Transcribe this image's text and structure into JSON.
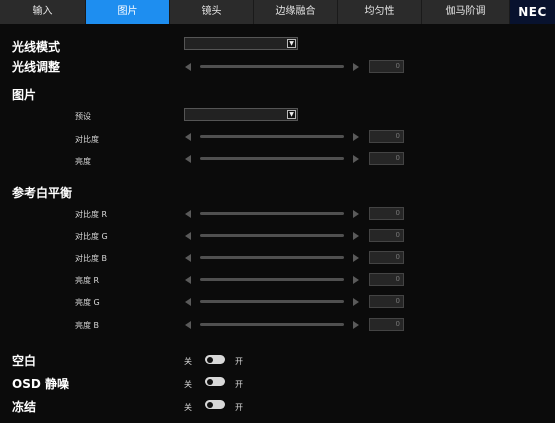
{
  "tabs": [
    {
      "label": "输入"
    },
    {
      "label": "图片"
    },
    {
      "label": "镜头"
    },
    {
      "label": "边缘融合"
    },
    {
      "label": "均匀性"
    },
    {
      "label": "伽马阶调"
    }
  ],
  "brand": {
    "logo_text": "NEC",
    "active_tab_color": "#1e8ef0"
  },
  "light": {
    "mode_label": "光线模式",
    "mode_value": "",
    "adjust_label": "光线调整",
    "adjust_value": "0"
  },
  "picture": {
    "heading": "图片",
    "preset_label": "预设",
    "preset_value": "",
    "contrast_label": "对比度",
    "contrast_value": "0",
    "brightness_label": "亮度",
    "brightness_value": "0"
  },
  "white_balance": {
    "heading": "参考白平衡",
    "items": [
      {
        "label": "对比度 R",
        "value": "0"
      },
      {
        "label": "对比度 G",
        "value": "0"
      },
      {
        "label": "对比度 B",
        "value": "0"
      },
      {
        "label": "亮度 R",
        "value": "0"
      },
      {
        "label": "亮度 G",
        "value": "0"
      },
      {
        "label": "亮度 B",
        "value": "0"
      }
    ]
  },
  "toggles": {
    "off_label": "关",
    "on_label": "开",
    "items": [
      {
        "label": "空白",
        "state": "off"
      },
      {
        "label": "OSD 静噪",
        "state": "off"
      },
      {
        "label": "冻结",
        "state": "off"
      }
    ]
  },
  "icons": {
    "dropdown_arrow": "chevron-down-icon",
    "slider_left": "triangle-left-icon",
    "slider_right": "triangle-right-icon"
  }
}
